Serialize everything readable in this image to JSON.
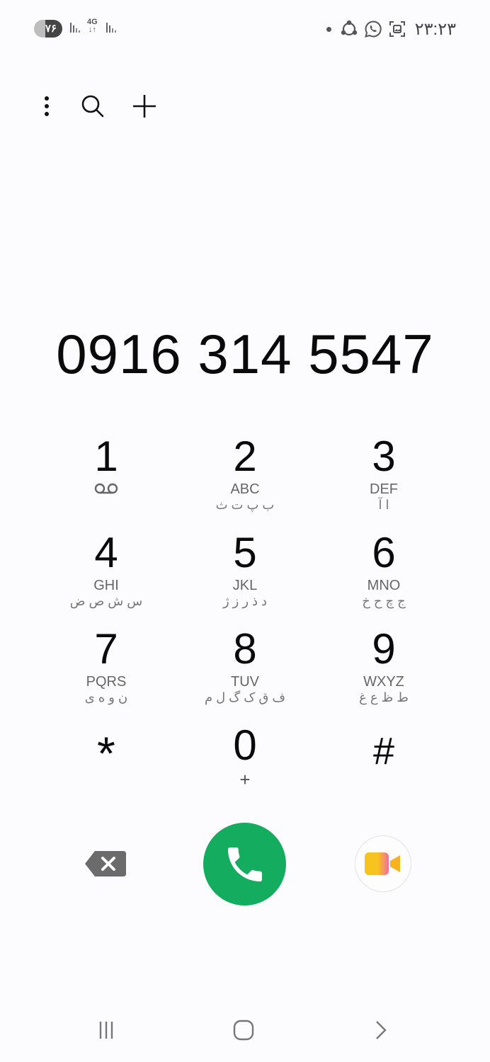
{
  "status_bar": {
    "battery": "۷۶",
    "network": "4G",
    "time": "۲۳:۲۳",
    "icons": [
      "signal-icon",
      "lte-icon",
      "signal-icon",
      "dot-icon",
      "share-icon",
      "whatsapp-icon",
      "screenshot-icon"
    ]
  },
  "toolbar": {
    "icons": [
      "more-options-icon",
      "search-icon",
      "add-contact-icon"
    ]
  },
  "dial_number": "0916 314 5547",
  "keypad": {
    "keys": [
      {
        "digit": "1",
        "letters": "",
        "persian": "",
        "sub_icon": "voicemail-icon"
      },
      {
        "digit": "2",
        "letters": "ABC",
        "persian": "ب پ ت ث"
      },
      {
        "digit": "3",
        "letters": "DEF",
        "persian": "ا آ"
      },
      {
        "digit": "4",
        "letters": "GHI",
        "persian": "س ش ص ض"
      },
      {
        "digit": "5",
        "letters": "JKL",
        "persian": "د ذ ر ز ژ"
      },
      {
        "digit": "6",
        "letters": "MNO",
        "persian": "ج چ ح خ"
      },
      {
        "digit": "7",
        "letters": "PQRS",
        "persian": "ن و ه ی"
      },
      {
        "digit": "8",
        "letters": "TUV",
        "persian": "ف ق ک گ ل م"
      },
      {
        "digit": "9",
        "letters": "WXYZ",
        "persian": "ط ظ ع غ"
      },
      {
        "digit": "*",
        "letters": "",
        "persian": ""
      },
      {
        "digit": "0",
        "letters": "+",
        "persian": ""
      },
      {
        "digit": "#",
        "letters": "",
        "persian": ""
      }
    ]
  },
  "actions": {
    "backspace_icon": "backspace-icon",
    "call_icon": "phone-icon",
    "video_icon": "video-call-icon"
  },
  "nav_bar": {
    "icons": [
      "recents-icon",
      "home-icon",
      "back-icon"
    ]
  },
  "colors": {
    "call_green": "#14ad5f",
    "background": "#fcfcfe",
    "video_yellow": "#f7c31e",
    "video_pink": "#f06ea0"
  }
}
